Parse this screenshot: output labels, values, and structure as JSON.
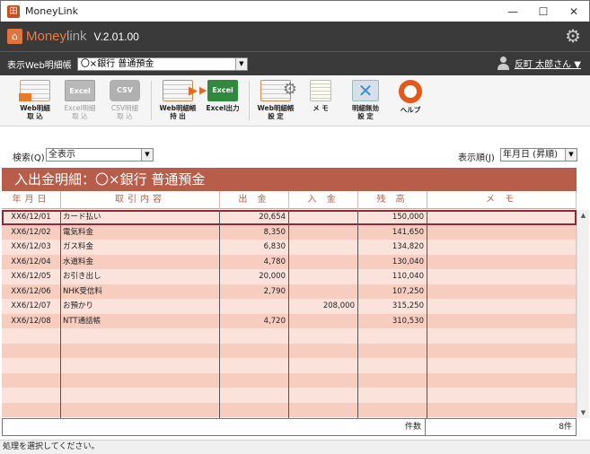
{
  "window": {
    "title": "MoneyLink",
    "icon_text": "田",
    "minimize": "—",
    "maximize": "☐",
    "close": "✕"
  },
  "header": {
    "logo_main": "Money",
    "logo_accent": "link",
    "version": "V.2.01.00"
  },
  "account_bar": {
    "label": "表示Web明細帳",
    "selected": "〇×銀行 普通預金",
    "user": "反町 太郎さん ▼"
  },
  "toolbar": {
    "web_import": "Web明細\n取 込",
    "excel_import": "Excel明細\n取 込",
    "excel_icon": "Excel",
    "csv_import": "CSV明細\n取 込",
    "csv_icon": "CSV",
    "web_export": "Web明細帳\n持 出",
    "excel_export": "Excel出力",
    "excel_out_icon": "Excel",
    "web_settings": "Web明細帳\n設 定",
    "memo": "メ モ",
    "invalid_settings": "明細無効\n設 定",
    "help": "ヘルプ"
  },
  "search": {
    "label": "検索(Q)",
    "value": "全表示",
    "sort_label": "表示順(J)",
    "sort_value": "年月日 (昇順)"
  },
  "table": {
    "title": "入出金明細：〇×銀行 普通預金",
    "columns": [
      "年月日",
      "取引内容",
      "出 金",
      "入 金",
      "残 高",
      "メ モ"
    ],
    "rows": [
      {
        "date": "XX6/12/01",
        "desc": "カード払い",
        "out": "20,654",
        "in": "",
        "balance": "150,000",
        "memo": ""
      },
      {
        "date": "XX6/12/02",
        "desc": "電気料金",
        "out": "8,350",
        "in": "",
        "balance": "141,650",
        "memo": ""
      },
      {
        "date": "XX6/12/03",
        "desc": "ガス料金",
        "out": "6,830",
        "in": "",
        "balance": "134,820",
        "memo": ""
      },
      {
        "date": "XX6/12/04",
        "desc": "水道料金",
        "out": "4,780",
        "in": "",
        "balance": "130,040",
        "memo": ""
      },
      {
        "date": "XX6/12/05",
        "desc": "お引き出し",
        "out": "20,000",
        "in": "",
        "balance": "110,040",
        "memo": ""
      },
      {
        "date": "XX6/12/06",
        "desc": "NHK受信料",
        "out": "2,790",
        "in": "",
        "balance": "107,250",
        "memo": ""
      },
      {
        "date": "XX6/12/07",
        "desc": "お預かり",
        "out": "",
        "in": "208,000",
        "balance": "315,250",
        "memo": ""
      },
      {
        "date": "XX6/12/08",
        "desc": "NTT通話帳",
        "out": "4,720",
        "in": "",
        "balance": "310,530",
        "memo": ""
      }
    ],
    "empty_rows": 6,
    "footer_label": "件数",
    "footer_count": "8件"
  },
  "status": "処理を選択してください。"
}
